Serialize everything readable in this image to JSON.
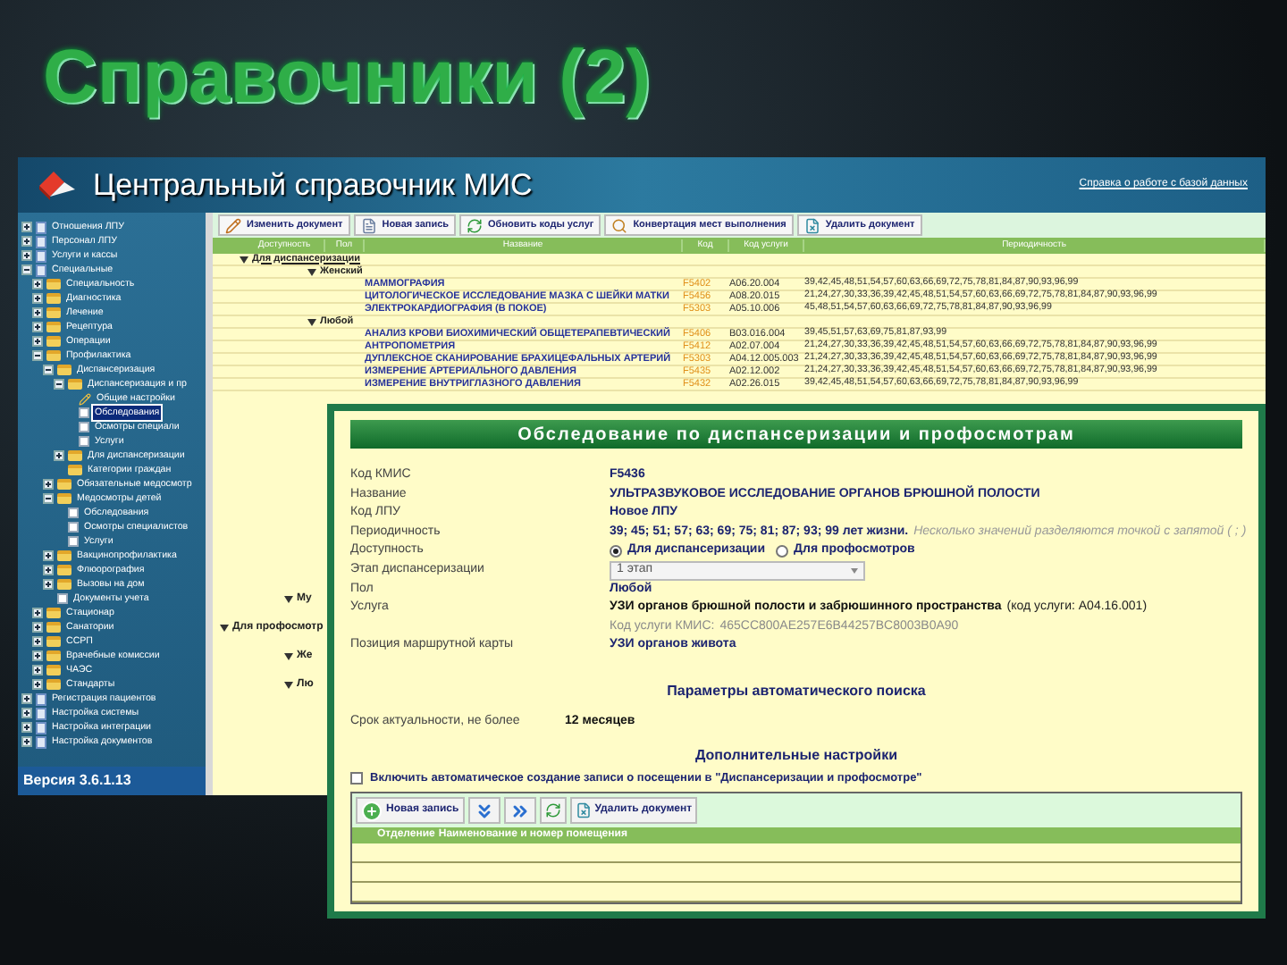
{
  "slide_title": "Справочники (2)",
  "app": {
    "title": "Центральный справочник МИС",
    "help_link": "Справка о работе с базой данных",
    "version": "Версия 3.6.1.13"
  },
  "tree": [
    {
      "label": "Отношения ЛПУ",
      "kind": "list",
      "expanded": false,
      "selected": false
    },
    {
      "label": "Персонал ЛПУ",
      "kind": "list",
      "expanded": false,
      "selected": false
    },
    {
      "label": "Услуги и кассы",
      "kind": "list",
      "expanded": false,
      "selected": false
    },
    {
      "label": "Специальные",
      "kind": "list",
      "expanded": true,
      "selected": false,
      "children": [
        {
          "label": "Специальность",
          "kind": "folder",
          "expanded": false,
          "selected": false
        },
        {
          "label": "Диагностика",
          "kind": "folder",
          "expanded": false,
          "selected": false
        },
        {
          "label": "Лечение",
          "kind": "folder",
          "expanded": false,
          "selected": false
        },
        {
          "label": "Рецептура",
          "kind": "folder",
          "expanded": false,
          "selected": false
        },
        {
          "label": "Операции",
          "kind": "folder",
          "expanded": false,
          "selected": false
        },
        {
          "label": "Профилактика",
          "kind": "folder",
          "expanded": true,
          "selected": false,
          "children": [
            {
              "label": "Диспансеризация",
              "kind": "folder",
              "expanded": true,
              "selected": false,
              "children": [
                {
                  "label": "Диспансеризация и пр",
                  "kind": "folder",
                  "expanded": true,
                  "selected": false,
                  "children": [
                    {
                      "label": "Общие настройки",
                      "kind": "tool",
                      "selected": false
                    },
                    {
                      "label": "Обследования",
                      "kind": "page",
                      "selected": true
                    },
                    {
                      "label": "Осмотры специали",
                      "kind": "page",
                      "selected": false
                    },
                    {
                      "label": "Услуги",
                      "kind": "page",
                      "selected": false
                    }
                  ]
                },
                {
                  "label": "Для диспансеризации",
                  "kind": "folder",
                  "expanded": false,
                  "selected": false
                },
                {
                  "label": "Категории граждан",
                  "kind": "folder",
                  "selected": false
                }
              ]
            },
            {
              "label": "Обязательные медосмотр",
              "kind": "folder",
              "expanded": false,
              "selected": false
            },
            {
              "label": "Медосмотры детей",
              "kind": "folder",
              "expanded": true,
              "selected": false,
              "children": [
                {
                  "label": "Обследования",
                  "kind": "page",
                  "selected": false
                },
                {
                  "label": "Осмотры специалистов",
                  "kind": "page",
                  "selected": false
                },
                {
                  "label": "Услуги",
                  "kind": "page",
                  "selected": false
                }
              ]
            },
            {
              "label": "Вакцинопрофилактика",
              "kind": "folder",
              "expanded": false,
              "selected": false
            },
            {
              "label": "Флюорография",
              "kind": "folder",
              "expanded": false,
              "selected": false
            },
            {
              "label": "Вызовы на дом",
              "kind": "folder",
              "expanded": false,
              "selected": false
            },
            {
              "label": "Документы учета",
              "kind": "page",
              "selected": false
            }
          ]
        },
        {
          "label": "Стационар",
          "kind": "folder",
          "expanded": false,
          "selected": false
        },
        {
          "label": "Санатории",
          "kind": "folder",
          "expanded": false,
          "selected": false
        },
        {
          "label": "ССРП",
          "kind": "folder",
          "expanded": false,
          "selected": false
        },
        {
          "label": "Врачебные комиссии",
          "kind": "folder",
          "expanded": false,
          "selected": false
        },
        {
          "label": "ЧАЭС",
          "kind": "folder",
          "expanded": false,
          "selected": false
        },
        {
          "label": "Стандарты",
          "kind": "folder",
          "expanded": false,
          "selected": false
        }
      ]
    },
    {
      "label": "Регистрация пациентов",
      "kind": "list",
      "expanded": false,
      "selected": false
    },
    {
      "label": "Настройка системы",
      "kind": "list",
      "expanded": false,
      "selected": false
    },
    {
      "label": "Настройка интеграции",
      "kind": "list",
      "expanded": false,
      "selected": false
    },
    {
      "label": "Настройка документов",
      "kind": "list",
      "expanded": false,
      "selected": false
    }
  ],
  "toolbar": [
    {
      "label": "Изменить документ",
      "kind": "pencil"
    },
    {
      "label": "Новая запись",
      "kind": "doc"
    },
    {
      "label": "Обновить коды услуг",
      "kind": "refresh"
    },
    {
      "label": "Конвертация мест выполнения",
      "kind": "search"
    },
    {
      "label": "Удалить документ",
      "kind": "delete"
    }
  ],
  "table": {
    "columns": [
      "Доступность",
      "Пол",
      "Название",
      "Код",
      "Код услуги",
      "Периодичность"
    ],
    "rows": [
      {
        "kind": "group",
        "label": "Для диспансеризации",
        "expanded": true
      },
      {
        "kind": "subgroup",
        "label": "Женский",
        "expanded": true
      },
      {
        "kind": "item",
        "name": "МАММОГРАФИЯ",
        "code": "F5402",
        "service_code": "A06.20.004",
        "periodicity": "39,42,45,48,51,54,57,60,63,66,69,72,75,78,81,84,87,90,93,96,99"
      },
      {
        "kind": "item",
        "name": "ЦИТОЛОГИЧЕСКОЕ ИССЛЕДОВАНИЕ МАЗКА С ШЕЙКИ МАТКИ",
        "code": "F5456",
        "service_code": "A08.20.015",
        "periodicity": "21,24,27,30,33,36,39,42,45,48,51,54,57,60,63,66,69,72,75,78,81,84,87,90,93,96,99"
      },
      {
        "kind": "item",
        "name": "ЭЛЕКТРОКАРДИОГРАФИЯ (В ПОКОЕ)",
        "code": "F5303",
        "service_code": "A05.10.006",
        "periodicity": "45,48,51,54,57,60,63,66,69,72,75,78,81,84,87,90,93,96,99"
      },
      {
        "kind": "subgroup",
        "label": "Любой",
        "expanded": true
      },
      {
        "kind": "item",
        "name": "АНАЛИЗ КРОВИ БИОХИМИЧЕСКИЙ ОБЩЕТЕРАПЕВТИЧЕСКИЙ",
        "code": "F5406",
        "service_code": "B03.016.004",
        "periodicity": "39,45,51,57,63,69,75,81,87,93,99"
      },
      {
        "kind": "item",
        "name": "АНТРОПОМЕТРИЯ",
        "code": "F5412",
        "service_code": "A02.07.004",
        "periodicity": "21,24,27,30,33,36,39,42,45,48,51,54,57,60,63,66,69,72,75,78,81,84,87,90,93,96,99"
      },
      {
        "kind": "item",
        "name": "ДУПЛЕКСНОЕ СКАНИРОВАНИЕ БРАХИЦЕФАЛЬНЫХ АРТЕРИЙ",
        "code": "F5303",
        "service_code": "A04.12.005.003",
        "periodicity": "21,24,27,30,33,36,39,42,45,48,51,54,57,60,63,66,69,72,75,78,81,84,87,90,93,96,99"
      },
      {
        "kind": "item",
        "name": "ИЗМЕРЕНИЕ АРТЕРИАЛЬНОГО ДАВЛЕНИЯ",
        "code": "F5435",
        "service_code": "A02.12.002",
        "periodicity": "21,24,27,30,33,36,39,42,45,48,51,54,57,60,63,66,69,72,75,78,81,84,87,90,93,96,99"
      },
      {
        "kind": "item",
        "name": "ИЗМЕРЕНИЕ ВНУТРИГЛАЗНОГО ДАВЛЕНИЯ",
        "code": "F5432",
        "service_code": "A02.26.015",
        "periodicity": "39,42,45,48,51,54,57,60,63,66,69,72,75,78,81,84,87,90,93,96,99"
      }
    ],
    "partial_rows": [
      {
        "kind": "subgroup",
        "label": "Му",
        "expanded": true
      },
      {
        "kind": "group",
        "label": "Для профосмотр",
        "expanded": true
      },
      {
        "kind": "subgroup",
        "label": "Же",
        "expanded": true
      },
      {
        "kind": "subgroup",
        "label": "Лю",
        "expanded": true
      }
    ]
  },
  "dialog": {
    "title": "Обследование по диспансеризации и профосмотрам",
    "fields": [
      {
        "kind": "text",
        "label": "Код КМИС",
        "value": "F5436"
      },
      {
        "kind": "text",
        "label": "Название",
        "value": "УЛЬТРАЗВУКОВОЕ ИССЛЕДОВАНИЕ ОРГАНОВ БРЮШНОЙ ПОЛОСТИ"
      },
      {
        "kind": "text",
        "label": "Код ЛПУ",
        "value": "Новое ЛПУ"
      },
      {
        "kind": "periodicity",
        "label": "Периодичность",
        "value": "39; 45; 51; 57; 63; 69; 75; 81; 87; 93; 99 лет жизни.",
        "hint": "Несколько значений разделяются точкой с запятой ( ; )"
      },
      {
        "kind": "radio",
        "label": "Доступность",
        "options": [
          {
            "label": "Для диспансеризации",
            "selected": true
          },
          {
            "label": "Для профосмотров",
            "selected": false
          }
        ]
      },
      {
        "kind": "select",
        "label": "Этап диспансеризации",
        "value": "1 этап"
      },
      {
        "kind": "text",
        "label": "Пол",
        "value": "Любой"
      },
      {
        "kind": "service",
        "label": "Услуга",
        "value": "УЗИ органов брюшной полости и забрюшинного пространства",
        "code": "(код услуги: A04.16.001)",
        "kmis_label": "Код услуги КМИС:",
        "kmis_code": "465CC800AE257E6B44257BC8003B0A90"
      },
      {
        "kind": "text",
        "label": "Позиция маршрутной карты",
        "value": "УЗИ органов живота"
      }
    ],
    "search_section": "Параметры автоматического поиска",
    "search_field": {
      "label": "Срок актуальности, не более",
      "value": "12 месяцев"
    },
    "extra_section": "Дополнительные настройки",
    "auto_create": {
      "label": "Включить автоматическое создание записи о посещении в \"Диспансеризации и профосмотре\"",
      "checked": false
    },
    "toolbar": [
      {
        "kind": "plus",
        "label": "Новая запись"
      },
      {
        "kind": "down"
      },
      {
        "kind": "right"
      },
      {
        "kind": "refresh"
      },
      {
        "kind": "delete",
        "label": "Удалить документ"
      }
    ],
    "grid_columns": [
      "Отделение",
      "Наименование и номер помещения"
    ]
  }
}
